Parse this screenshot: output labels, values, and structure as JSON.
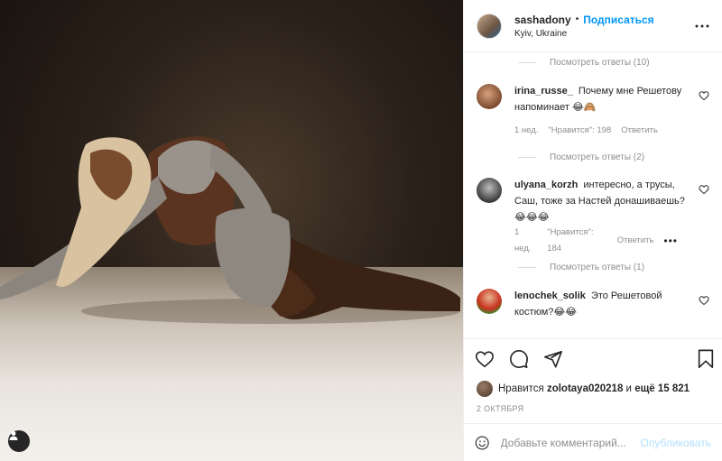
{
  "header": {
    "username": "sashadony",
    "separator": "•",
    "follow_label": "Подписаться",
    "location": "Kyiv, Ukraine"
  },
  "comments_area": {
    "replies_top": "Посмотреть ответы (10)",
    "comments": [
      {
        "username": "irina_russe_",
        "text": "Почему мне Решетову напоминает 😂🙈",
        "time": "1 нед.",
        "likes": "\"Нравится\": 198",
        "reply_label": "Ответить",
        "view_replies": "Посмотреть ответы (2)"
      },
      {
        "username": "ulyana_korzh",
        "text": "интересно, а трусы, Саш, тоже за Настей донашиваешь?😂😂😂",
        "time": "1 нед.",
        "likes": "\"Нравится\": 184",
        "reply_label": "Ответить",
        "more": "•••",
        "view_replies": "Посмотреть ответы (1)"
      },
      {
        "username": "lenochek_solik",
        "text": "Это Решетовой костюм?😂😂"
      }
    ]
  },
  "likes_bar": {
    "prefix": "Нравится",
    "liker": "zolotaya020218",
    "middle": "и",
    "others": "ещё 15 821"
  },
  "date": "2 ОКТЯБРЯ",
  "add_comment": {
    "placeholder": "Добавьте комментарий...",
    "publish_label": "Опубликовать"
  },
  "colors": {
    "accent": "#0095f6",
    "muted": "#8e8e8e",
    "text": "#262626",
    "publish_disabled": "#b2dffc"
  }
}
